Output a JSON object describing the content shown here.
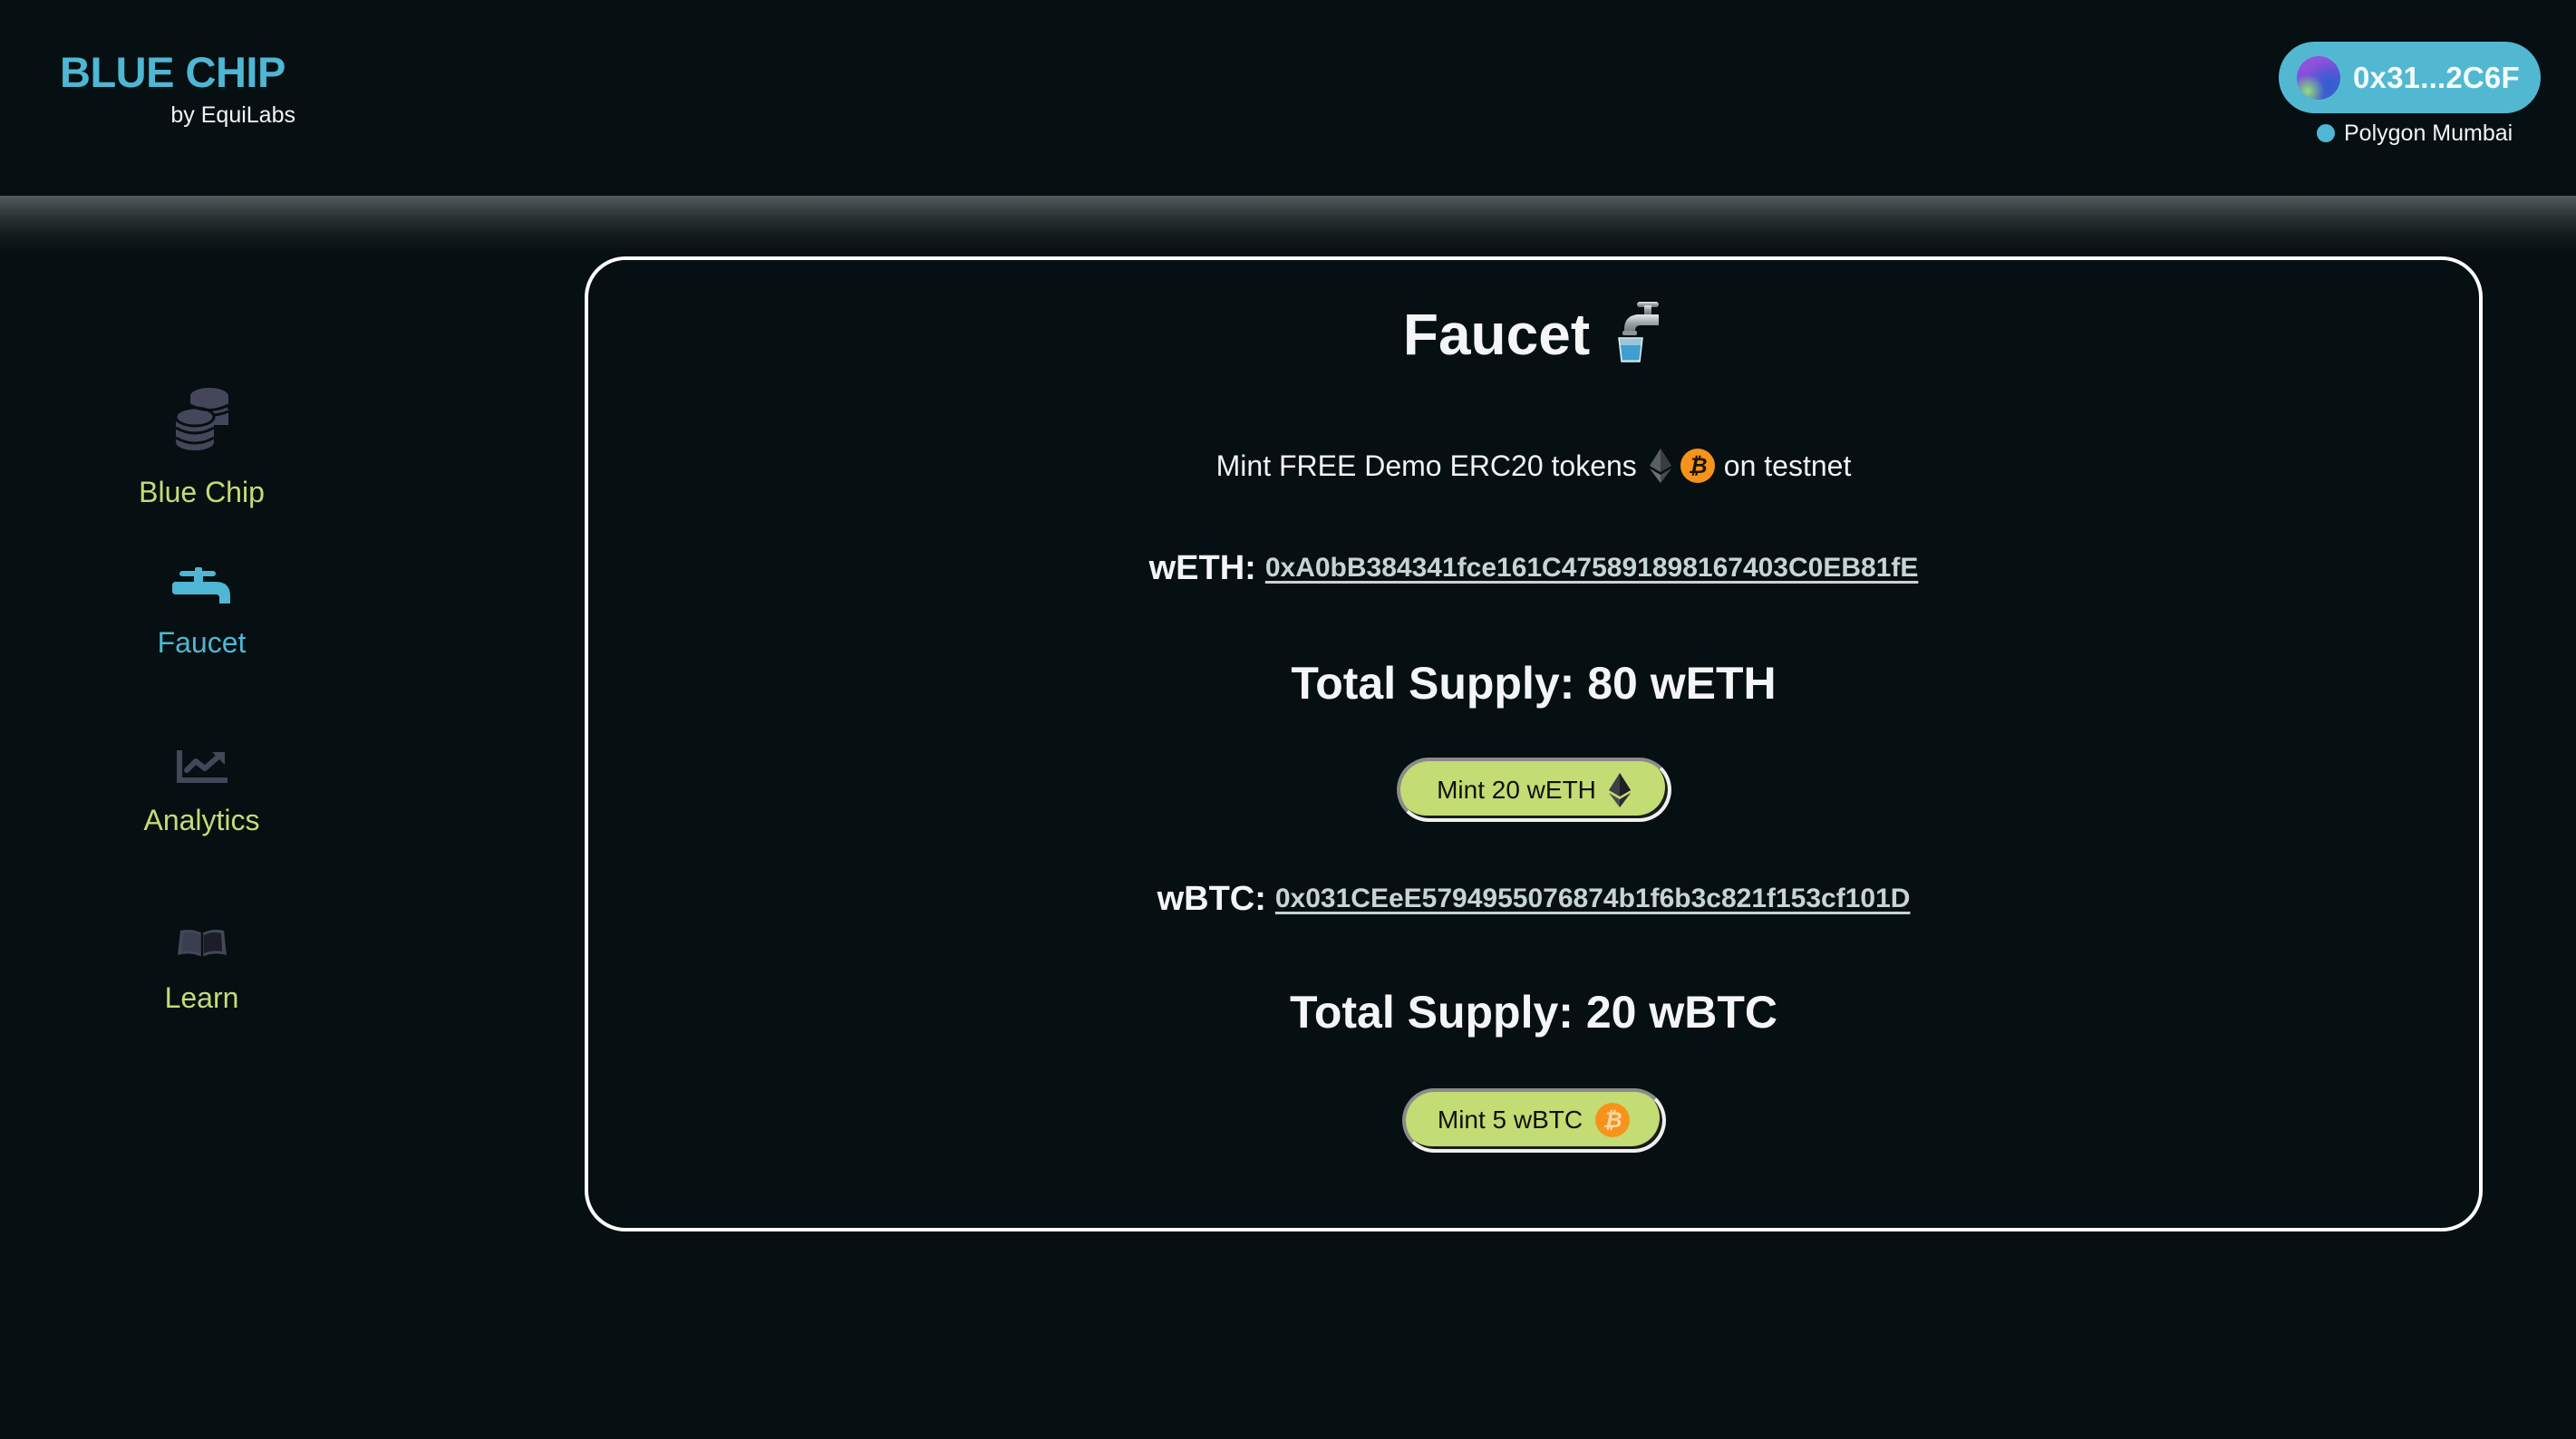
{
  "header": {
    "logo_title": "BLUE CHIP",
    "logo_subtitle": "by EquiLabs",
    "wallet": {
      "address_short": "0x31...2C6F",
      "avatar_icon": "gradient-avatar-icon",
      "network": "Polygon Mumbai",
      "network_status_color": "#4fb6d3"
    }
  },
  "sidebar": {
    "items": [
      {
        "label": "Blue Chip",
        "icon": "coins-stack-icon",
        "active": false
      },
      {
        "label": "Faucet",
        "icon": "faucet-icon",
        "active": true
      },
      {
        "label": "Analytics",
        "icon": "chart-line-icon",
        "active": false
      },
      {
        "label": "Learn",
        "icon": "open-book-icon",
        "active": false
      }
    ]
  },
  "main": {
    "title": "Faucet",
    "title_emoji": "🚰",
    "subtitle_before": "Mint FREE Demo ERC20 tokens",
    "subtitle_after": "on testnet",
    "tokens": [
      {
        "label": "wETH:",
        "address": "0xA0bB384341fce161C475891898167403C0EB81fE",
        "total_supply": "Total Supply: 80 wETH",
        "mint_label": "Mint 20 wETH",
        "icon": "ethereum-icon"
      },
      {
        "label": "wBTC:",
        "address": "0x031CEeE5794955076874b1f6b3c821f153cf101D",
        "total_supply": "Total Supply: 20 wBTC",
        "mint_label": "Mint 5 wBTC",
        "icon": "bitcoin-icon"
      }
    ]
  },
  "colors": {
    "background": "#060f11",
    "accent_blue": "#4fb6d3",
    "accent_green": "#c3dc77",
    "button_green": "#c3dc73",
    "bitcoin_orange": "#f7931a"
  }
}
